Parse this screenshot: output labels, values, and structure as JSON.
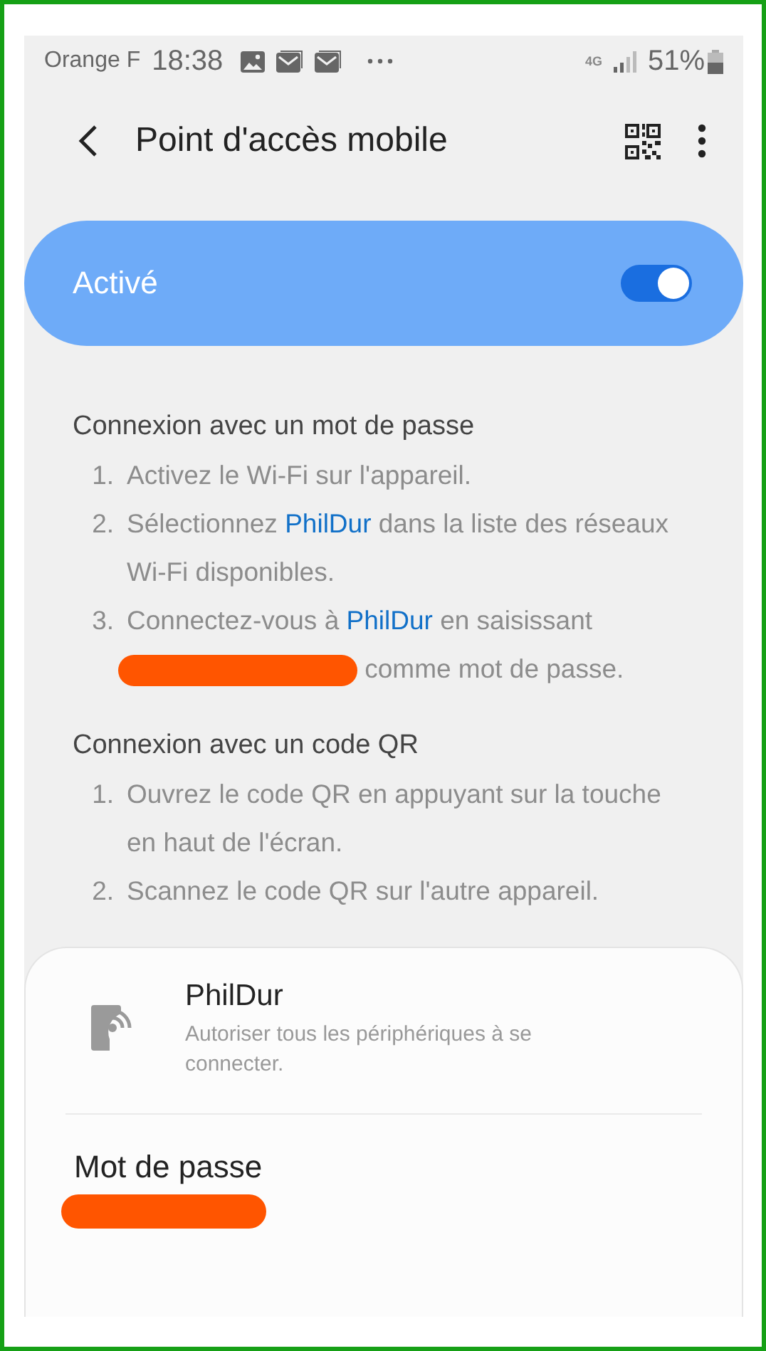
{
  "status_bar": {
    "carrier": "Orange F",
    "time": "18:38",
    "network": "4G",
    "battery": "51%"
  },
  "header": {
    "title": "Point d'accès mobile"
  },
  "master_switch": {
    "label": "Activé",
    "on": true
  },
  "sections": [
    {
      "title": "Connexion avec un mot de passe",
      "steps": [
        {
          "number": "1.",
          "segments": [
            {
              "kind": "text",
              "text": "Activez le Wi-Fi sur l'appareil."
            }
          ]
        },
        {
          "number": "2.",
          "segments": [
            {
              "kind": "text",
              "text": "Sélectionnez "
            },
            {
              "kind": "link",
              "text": "PhilDur"
            },
            {
              "kind": "text",
              "text": " dans la liste des réseaux Wi-Fi disponibles."
            }
          ]
        },
        {
          "number": "3.",
          "segments": [
            {
              "kind": "text",
              "text": "Connectez-vous à "
            },
            {
              "kind": "link",
              "text": "PhilDur"
            },
            {
              "kind": "text",
              "text": " en saisissant"
            },
            {
              "kind": "redacted"
            },
            {
              "kind": "text",
              "text": " comme mot de passe."
            }
          ]
        }
      ]
    },
    {
      "title": "Connexion avec un code QR",
      "steps": [
        {
          "number": "1.",
          "segments": [
            {
              "kind": "text",
              "text": "Ouvrez le code QR en appuyant sur la touche en haut de l'écran."
            }
          ]
        },
        {
          "number": "2.",
          "segments": [
            {
              "kind": "text",
              "text": "Scannez le code QR sur l'autre appareil."
            }
          ]
        }
      ]
    }
  ],
  "network_card": {
    "name": "PhilDur",
    "description": "Autoriser tous les périphériques à se connecter.",
    "password_label": "Mot de passe"
  }
}
